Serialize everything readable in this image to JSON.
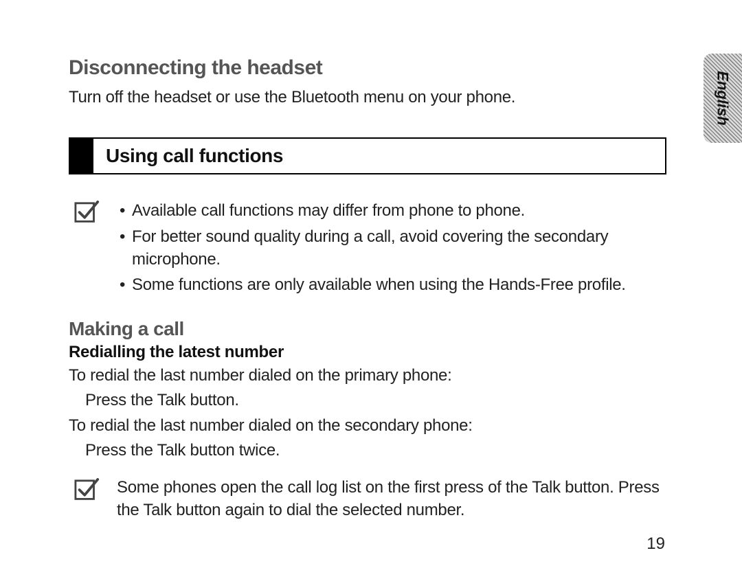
{
  "langTab": "English",
  "section1": {
    "heading": "Disconnecting the headset",
    "body": "Turn off the headset or use the Bluetooth menu on your phone."
  },
  "sectionBox": {
    "title": "Using call functions"
  },
  "note1": {
    "bullets": [
      "Available call functions may differ from phone to phone.",
      "For better sound quality during a call, avoid covering the secondary microphone.",
      "Some functions are only available when using the Hands-Free profile."
    ]
  },
  "section2": {
    "heading": "Making a call",
    "sub": "Redialling the latest number",
    "line1": "To redial the last number dialed on the primary phone:",
    "line1a": "Press the Talk button.",
    "line2": "To redial the last number dialed on the secondary phone:",
    "line2a": "Press the Talk button twice."
  },
  "note2": {
    "text": "Some phones open the call log list on the first press of the Talk button. Press the Talk button again to dial the selected number."
  },
  "pageNumber": "19"
}
